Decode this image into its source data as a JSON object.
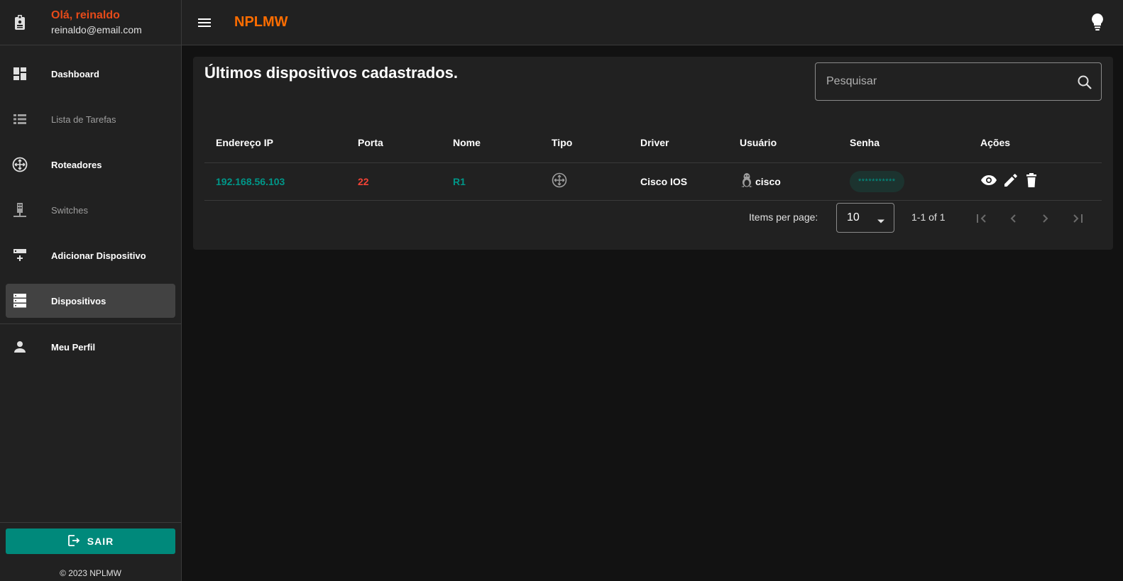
{
  "app": {
    "title": "NPLMW"
  },
  "user": {
    "greeting": "Olá, reinaldo",
    "email": "reinaldo@email.com"
  },
  "sidebar": {
    "items": [
      {
        "label": "Dashboard",
        "icon": "dashboard-icon"
      },
      {
        "label": "Lista de Tarefas",
        "icon": "list-icon"
      },
      {
        "label": "Roteadores",
        "icon": "router-icon"
      },
      {
        "label": "Switches",
        "icon": "switch-icon"
      },
      {
        "label": "Adicionar Dispositivo",
        "icon": "add-device-icon"
      },
      {
        "label": "Dispositivos",
        "icon": "devices-icon"
      },
      {
        "label": "Meu Perfil",
        "icon": "person-icon"
      }
    ],
    "active": "Dispositivos",
    "logout_label": "SAIR",
    "copyright": "© 2023 NPLMW"
  },
  "main": {
    "title": "Últimos dispositivos cadastrados.",
    "search": {
      "placeholder": "Pesquisar",
      "value": ""
    },
    "table": {
      "columns": [
        "Endereço IP",
        "Porta",
        "Nome",
        "Tipo",
        "Driver",
        "Usuário",
        "Senha",
        "Ações"
      ],
      "rows": [
        {
          "ip": "192.168.56.103",
          "port": "22",
          "name": "R1",
          "type_icon": "router-icon",
          "driver": "Cisco IOS",
          "user": "cisco",
          "user_icon": "linux-icon",
          "password": "***********"
        }
      ]
    },
    "pagination": {
      "items_per_page_label": "Items per page:",
      "items_per_page": "10",
      "range": "1-1 of 1"
    }
  },
  "colors": {
    "accent": "#009688",
    "brand": "#ff6d00",
    "greeting": "#e64a19",
    "port": "#f44336"
  }
}
